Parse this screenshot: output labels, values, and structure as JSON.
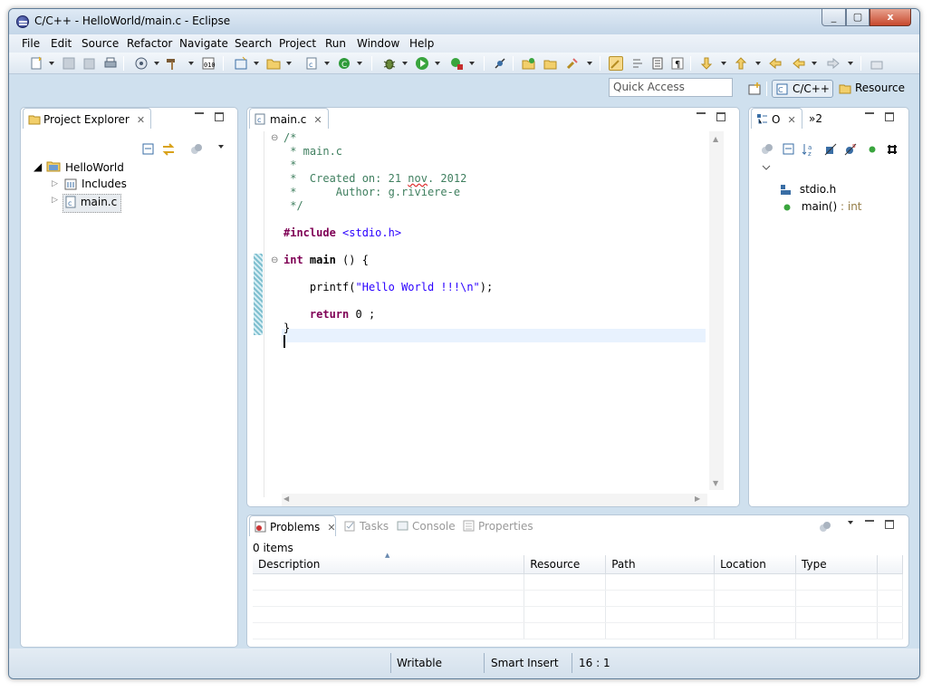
{
  "window": {
    "title": "C/C++ - HelloWorld/main.c - Eclipse",
    "close_glyph": "x",
    "min_glyph": "_",
    "max_glyph": "▢"
  },
  "menu": [
    "File",
    "Edit",
    "Source",
    "Refactor",
    "Navigate",
    "Search",
    "Project",
    "Run",
    "Window",
    "Help"
  ],
  "quick_access": {
    "placeholder": "Quick Access"
  },
  "perspectives": {
    "cpp": "C/C++",
    "resource": "Resource"
  },
  "project_explorer": {
    "tab_label": "Project Explorer",
    "project": "HelloWorld",
    "children": [
      "Includes",
      "main.c"
    ]
  },
  "editor": {
    "tab_label": "main.c",
    "lines": {
      "l1": "/*",
      "l2": " * main.c",
      "l3": " *",
      "l4a": " *  Created on: 21 ",
      "l4b": "nov",
      "l4c": ". 2012",
      "l5": " *      Author: g.riviere-e",
      "l6": " */",
      "inc_kw": "#include",
      "inc_file": "<stdio.h>",
      "main_kw": "int",
      "main_name": "main",
      "main_rest": " () {",
      "printf_fn": "printf",
      "printf_open": "(",
      "printf_str": "\"Hello World !!!\\n\"",
      "printf_close": ");",
      "ret_kw": "return",
      "ret_rest": " 0 ;",
      "close_brace": "}"
    }
  },
  "outline": {
    "tab_label": "O",
    "more_label": "»2",
    "items": [
      {
        "name": "stdio.h",
        "type": ""
      },
      {
        "name": "main()",
        "type": " : int"
      }
    ]
  },
  "bottom": {
    "tabs": [
      "Problems",
      "Tasks",
      "Console",
      "Properties"
    ],
    "count": "0 items",
    "columns": [
      "Description",
      "Resource",
      "Path",
      "Location",
      "Type"
    ]
  },
  "status": {
    "mode": "Writable",
    "insert": "Smart Insert",
    "position": "16 : 1"
  }
}
